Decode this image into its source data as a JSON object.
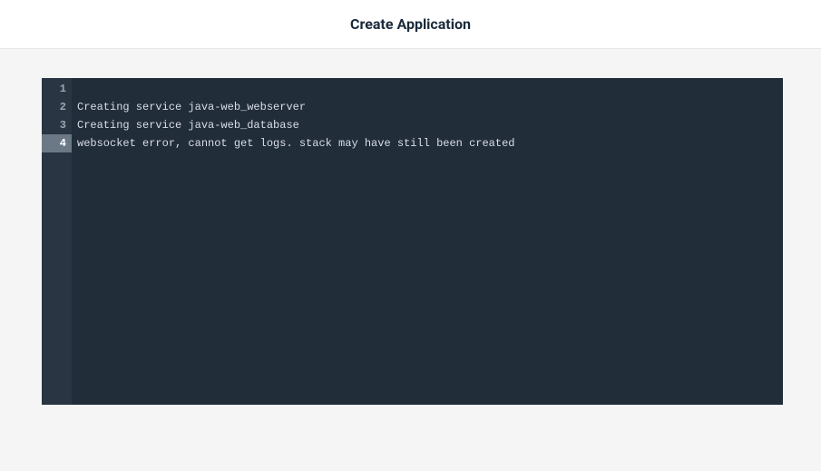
{
  "header": {
    "title": "Create Application"
  },
  "editor": {
    "activeLine": 4,
    "lines": [
      {
        "num": "1",
        "text": ""
      },
      {
        "num": "2",
        "text": "Creating service java-web_webserver"
      },
      {
        "num": "3",
        "text": "Creating service java-web_database"
      },
      {
        "num": "4",
        "text": "websocket error, cannot get logs. stack may have still been created"
      }
    ]
  }
}
